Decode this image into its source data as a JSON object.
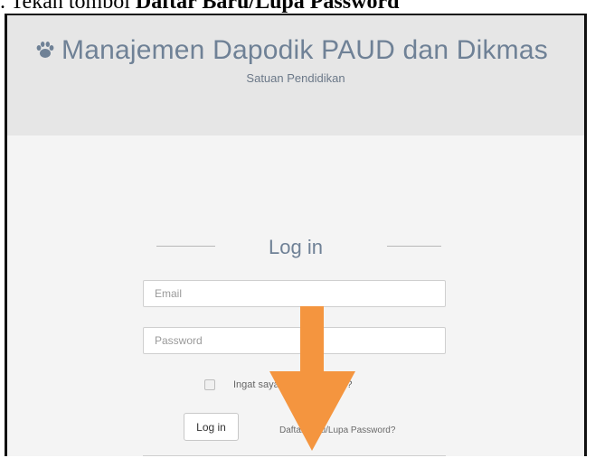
{
  "caption": {
    "prefix": ". Tekan tombol ",
    "highlight": "Daftar Baru/Lupa Password"
  },
  "header": {
    "app_title": "Manajemen Dapodik PAUD dan Dikmas",
    "subtitle": "Satuan Pendidikan",
    "logo_icon": "paw-icon"
  },
  "login": {
    "heading": "Log in",
    "email_placeholder": "Email",
    "password_placeholder": "Password",
    "remember_label": "Ingat saya di komputer ini?",
    "remember_checked": false,
    "login_button": "Log in",
    "forgot_link": "Daftar Baru/Lupa Password?"
  },
  "annotation": {
    "arrow_icon": "arrow-down-icon",
    "arrow_color": "#f4953f"
  },
  "colors": {
    "title": "#6f8196",
    "header_bg": "#e6e6e6",
    "page_bg": "#f4f4f4"
  }
}
